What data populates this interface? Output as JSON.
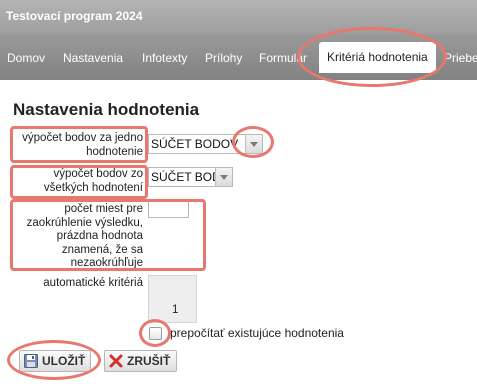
{
  "app": {
    "title": "Testovací program 2024"
  },
  "nav": {
    "items": [
      {
        "label": "Domov"
      },
      {
        "label": "Nastavenia"
      },
      {
        "label": "Infotexty"
      },
      {
        "label": "Prílohy"
      },
      {
        "label": "Formulár"
      },
      {
        "label": "Kritériá hodnotenia",
        "active": true
      },
      {
        "label": "Priebeh"
      }
    ]
  },
  "form": {
    "heading": "Nastavenia hodnotenia",
    "field1": {
      "label": "výpočet bodov za jedno\nhodnotenie",
      "value": "SÚČET BODOV"
    },
    "field2": {
      "label": "výpočet bodov zo\nvšetkých hodnotení",
      "value": "SÚČET BODOV"
    },
    "field3": {
      "label": "počet miest pre\nzaokrúhlenie výsledku,\nprázdna hodnota\nznamená, že sa\nnezaokrúhľuje",
      "value": ""
    },
    "auto_criteria": {
      "label": "automatické kritériá",
      "value": "1"
    },
    "recalc": {
      "label": "prepočítať existujúce hodnotenia",
      "checked": false
    }
  },
  "buttons": {
    "save": "ULOŽIŤ",
    "cancel": "ZRUŠIŤ"
  },
  "colors": {
    "highlight": "#e8776d",
    "topbar": "#a8a8a8",
    "navbar": "#8e8e8e"
  },
  "icons": {
    "save": "floppy-disk-icon",
    "cancel": "x-icon",
    "dropdown": "chevron-down-icon"
  }
}
